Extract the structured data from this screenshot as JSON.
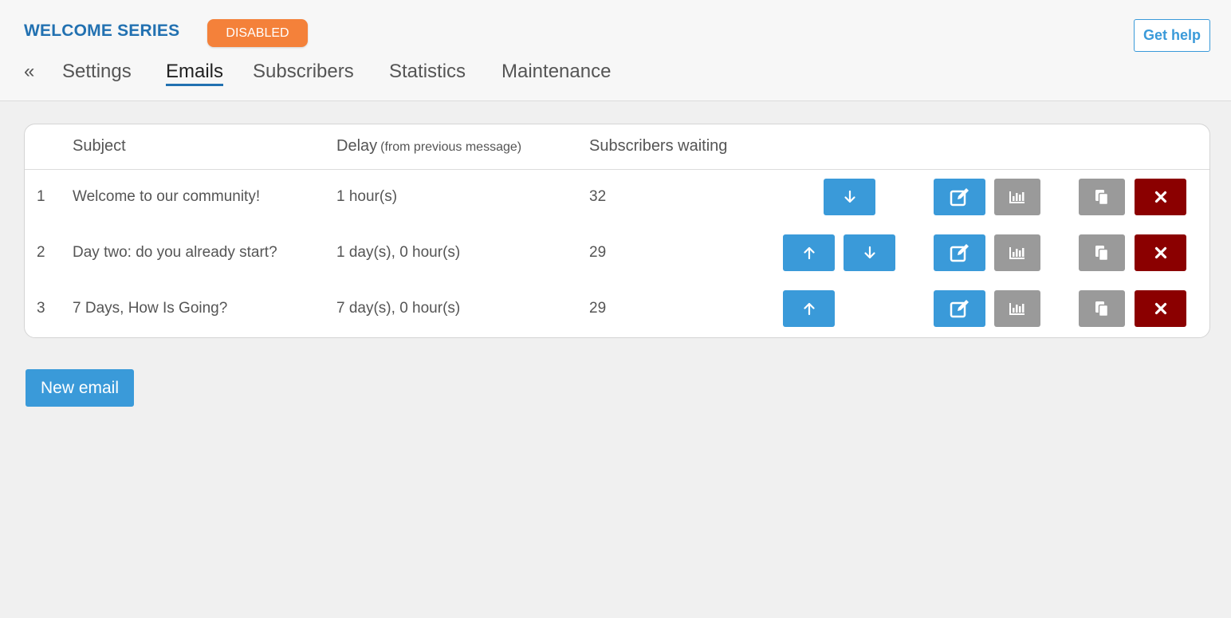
{
  "header": {
    "title": "WELCOME SERIES",
    "status": "DISABLED",
    "help_label": "Get help"
  },
  "tabs": [
    {
      "label": "«"
    },
    {
      "label": "Settings"
    },
    {
      "label": "Emails",
      "active": true
    },
    {
      "label": "Subscribers"
    },
    {
      "label": "Statistics"
    },
    {
      "label": "Maintenance"
    }
  ],
  "table": {
    "columns": {
      "subject": "Subject",
      "delay": "Delay",
      "delay_note": "(from previous message)",
      "waiting": "Subscribers waiting"
    },
    "rows": [
      {
        "num": "1",
        "subject": "Welcome to our community!",
        "delay": "1 hour(s)",
        "waiting": "32"
      },
      {
        "num": "2",
        "subject": "Day two: do you already start?",
        "delay": "1 day(s), 0 hour(s)",
        "waiting": "29"
      },
      {
        "num": "3",
        "subject": "7 Days, How Is Going?",
        "delay": "7 day(s), 0 hour(s)",
        "waiting": "29"
      }
    ]
  },
  "actions": {
    "new_email_label": "New email"
  },
  "icons": {
    "move_up": "arrow-up-icon",
    "move_down": "arrow-down-icon",
    "edit": "edit-icon",
    "stats": "bar-chart-icon",
    "copy": "copy-icon",
    "delete": "close-icon"
  },
  "colors": {
    "title": "#2271b1",
    "badge": "#f4813a",
    "primary": "#3a9ad9",
    "neutral": "#9a9a9a",
    "danger": "#8b0000"
  }
}
